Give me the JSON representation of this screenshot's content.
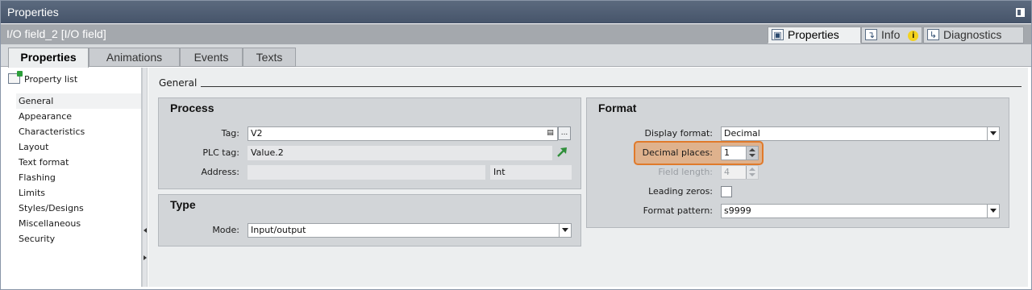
{
  "window": {
    "title": "Properties"
  },
  "object": {
    "title": "I/O field_2 [I/O field]"
  },
  "right_tabs": [
    {
      "label": "Properties",
      "icon": "properties-icon",
      "active": true
    },
    {
      "label": "Info",
      "icon": "info-icon",
      "badge": "i"
    },
    {
      "label": "Diagnostics",
      "icon": "diagnostics-icon"
    }
  ],
  "tabs": [
    {
      "label": "Properties",
      "active": true
    },
    {
      "label": "Animations"
    },
    {
      "label": "Events"
    },
    {
      "label": "Texts"
    }
  ],
  "property_list": {
    "label": "Property list",
    "items": [
      "General",
      "Appearance",
      "Characteristics",
      "Layout",
      "Text format",
      "Flashing",
      "Limits",
      "Styles/Designs",
      "Miscellaneous",
      "Security"
    ],
    "selected": "General"
  },
  "general": {
    "title": "General",
    "process": {
      "title": "Process",
      "tag_label": "Tag:",
      "tag_value": "V2",
      "tag_browse_label": "...",
      "plc_tag_label": "PLC tag:",
      "plc_tag_value": "Value.2",
      "address_label": "Address:",
      "address_value": "",
      "address_type": "Int"
    },
    "type": {
      "title": "Type",
      "mode_label": "Mode:",
      "mode_value": "Input/output"
    },
    "format": {
      "title": "Format",
      "display_format_label": "Display format:",
      "display_format_value": "Decimal",
      "decimal_places_label": "Decimal places:",
      "decimal_places_value": "1",
      "field_length_label": "Field length:",
      "field_length_value": "4",
      "leading_zeros_label": "Leading zeros:",
      "leading_zeros_checked": false,
      "format_pattern_label": "Format pattern:",
      "format_pattern_value": "s9999"
    }
  },
  "colors": {
    "titlebar": "#4f5d72",
    "highlight": "#e07a2b",
    "panel": "#d2d5d8"
  }
}
